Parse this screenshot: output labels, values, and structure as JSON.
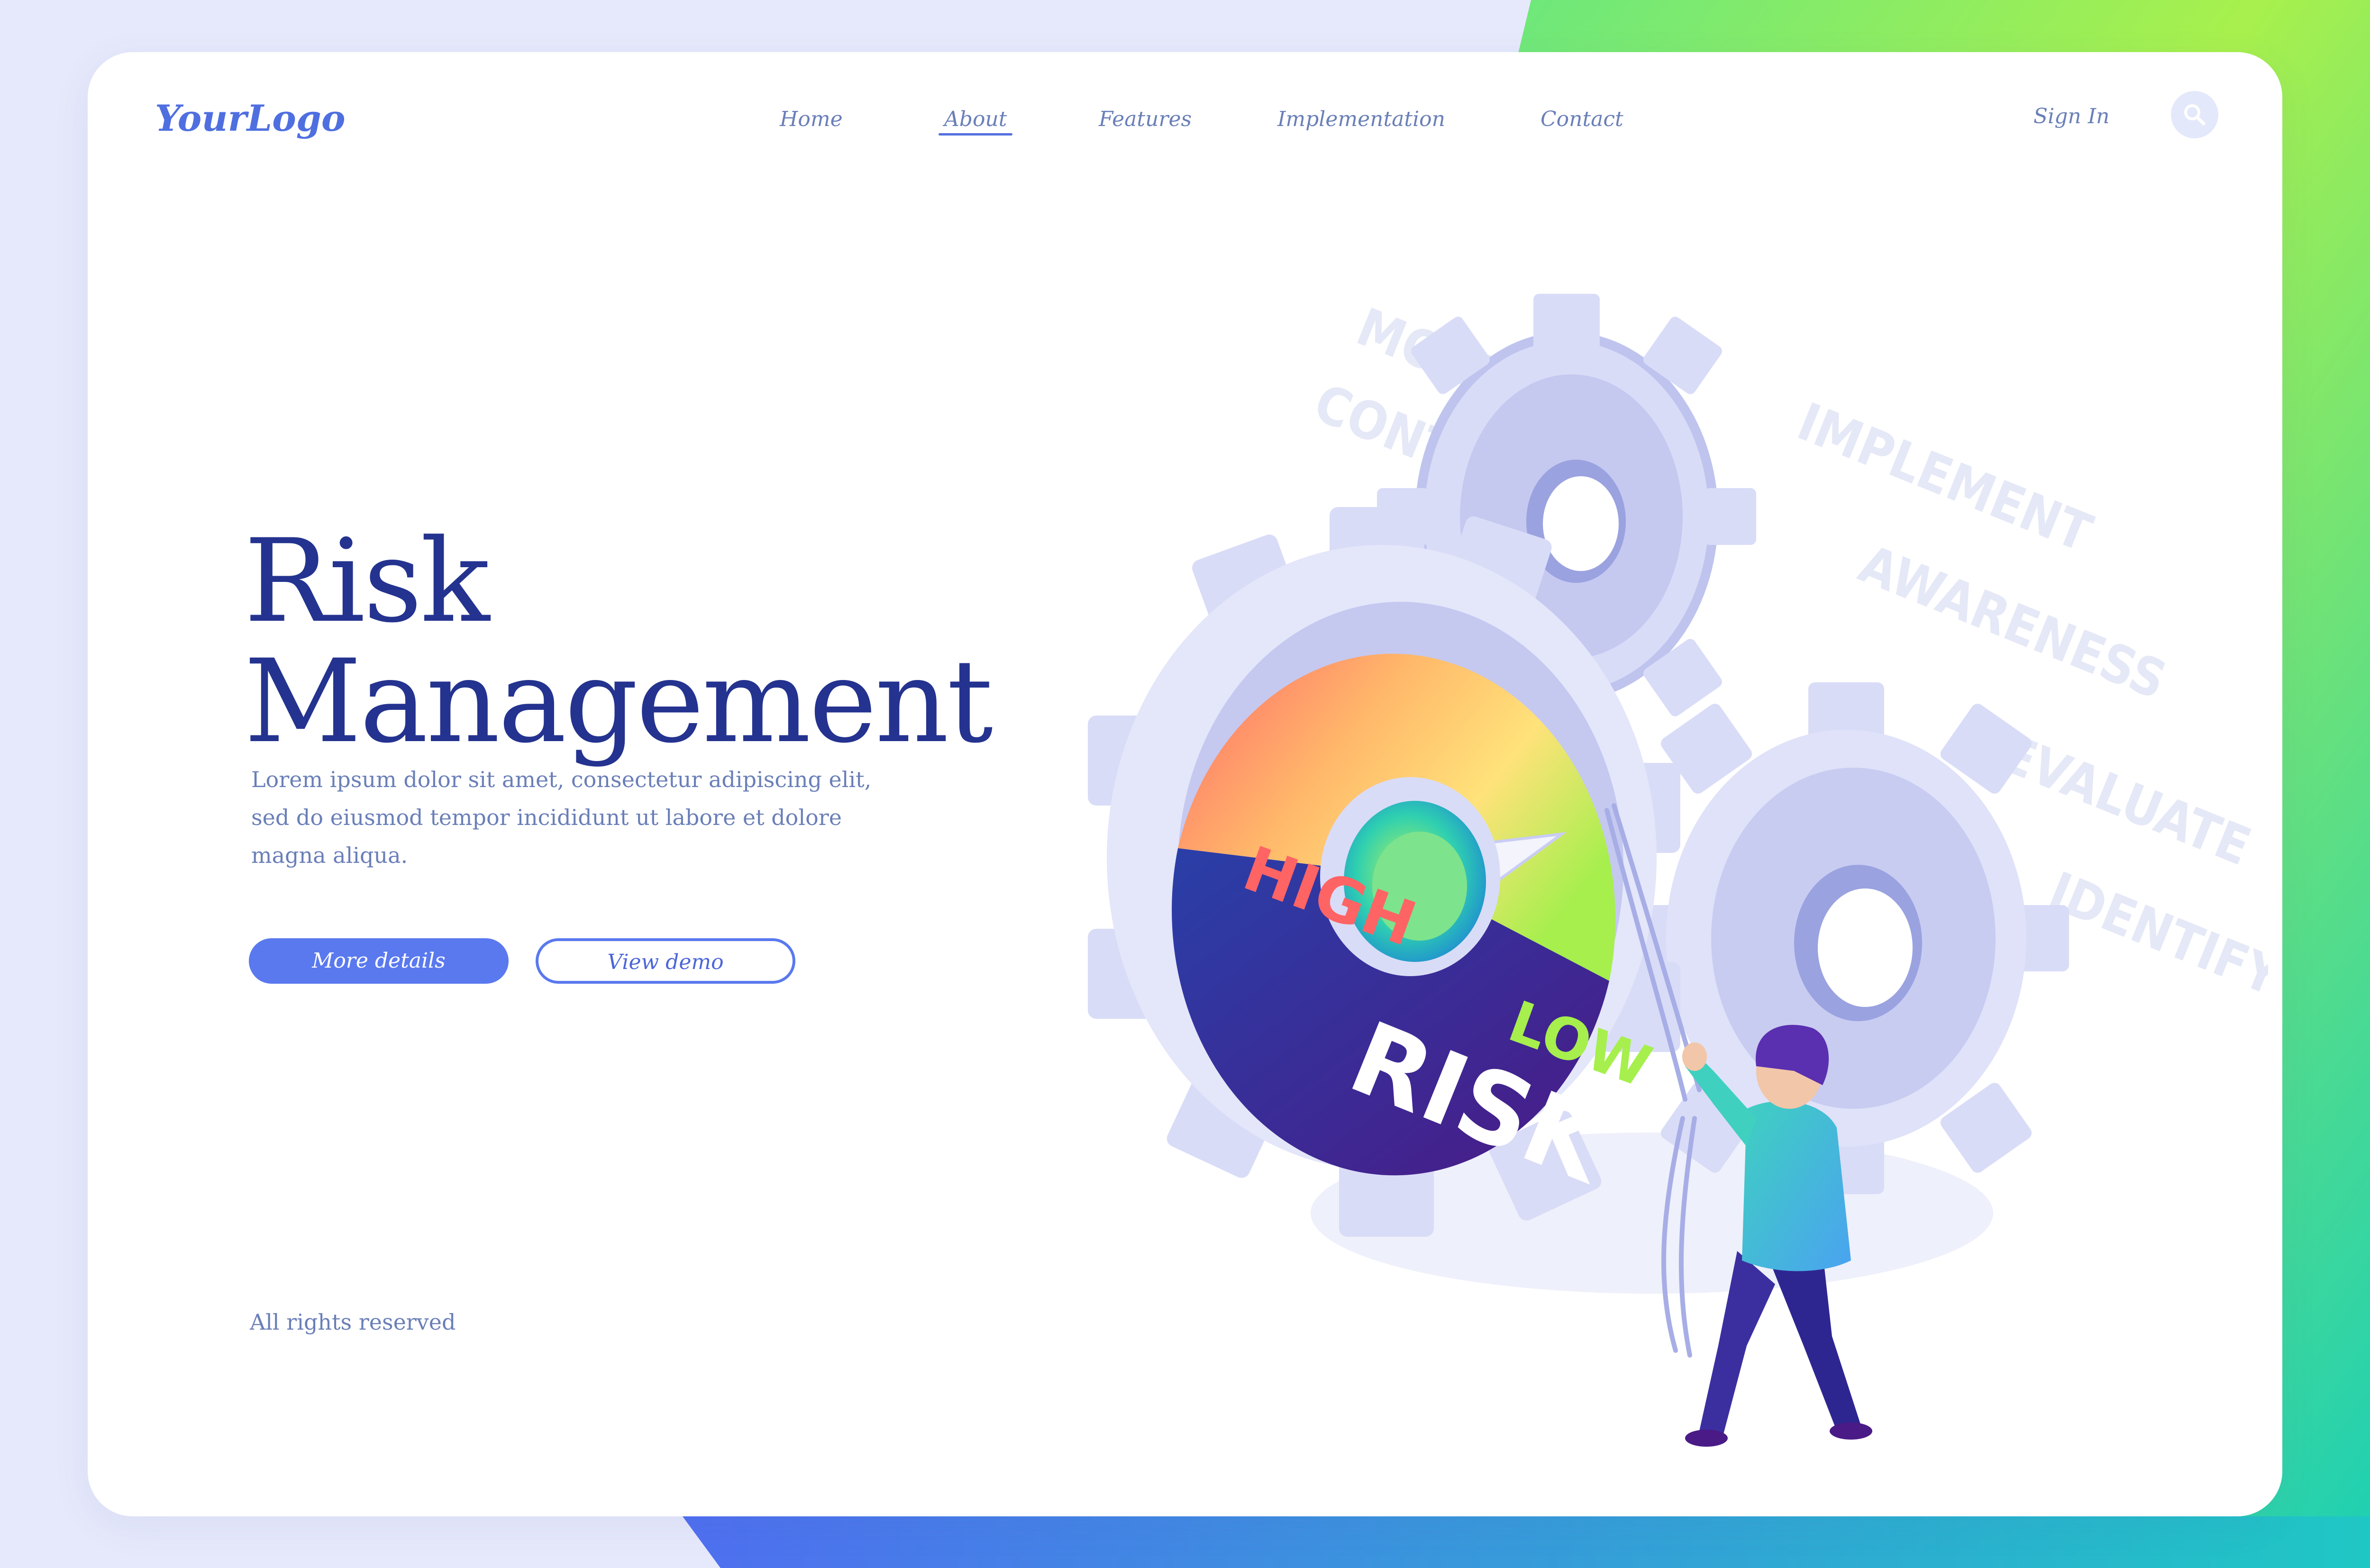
{
  "header": {
    "logo": "YourLogo",
    "nav": [
      "Home",
      "About",
      "Features",
      "Implementation",
      "Contact"
    ],
    "active_nav": "About",
    "sign_in": "Sign In",
    "search_icon": "search-icon"
  },
  "hero": {
    "title_line1": "Risk",
    "title_line2": "Management",
    "description_line1": "Lorem ipsum dolor sit amet, consectetur adipiscing elit,",
    "description_line2": "sed do eiusmod tempor incididunt ut labore et dolore",
    "description_line3": "magna aliqua.",
    "primary_button": "More details",
    "secondary_button": "View demo"
  },
  "footer": {
    "copyright": "All rights reserved"
  },
  "illustration": {
    "floating_words": [
      "MONITOR",
      "CONTROLS",
      "IMPLEMENT",
      "AWARENESS",
      "EVALUATE",
      "IDENTIFY"
    ],
    "dial_labels": {
      "high": "HIGH",
      "low": "LOW",
      "center": "RISK"
    }
  },
  "colors": {
    "accent": "#5a79ef",
    "title": "#24338f",
    "text": "#6a7fb8",
    "gear": "#c9cdf3",
    "gradient_left": "#e6e9fb",
    "gradient_right_top": "#a5f04e",
    "gradient_right_bottom": "#1ccfb5"
  }
}
